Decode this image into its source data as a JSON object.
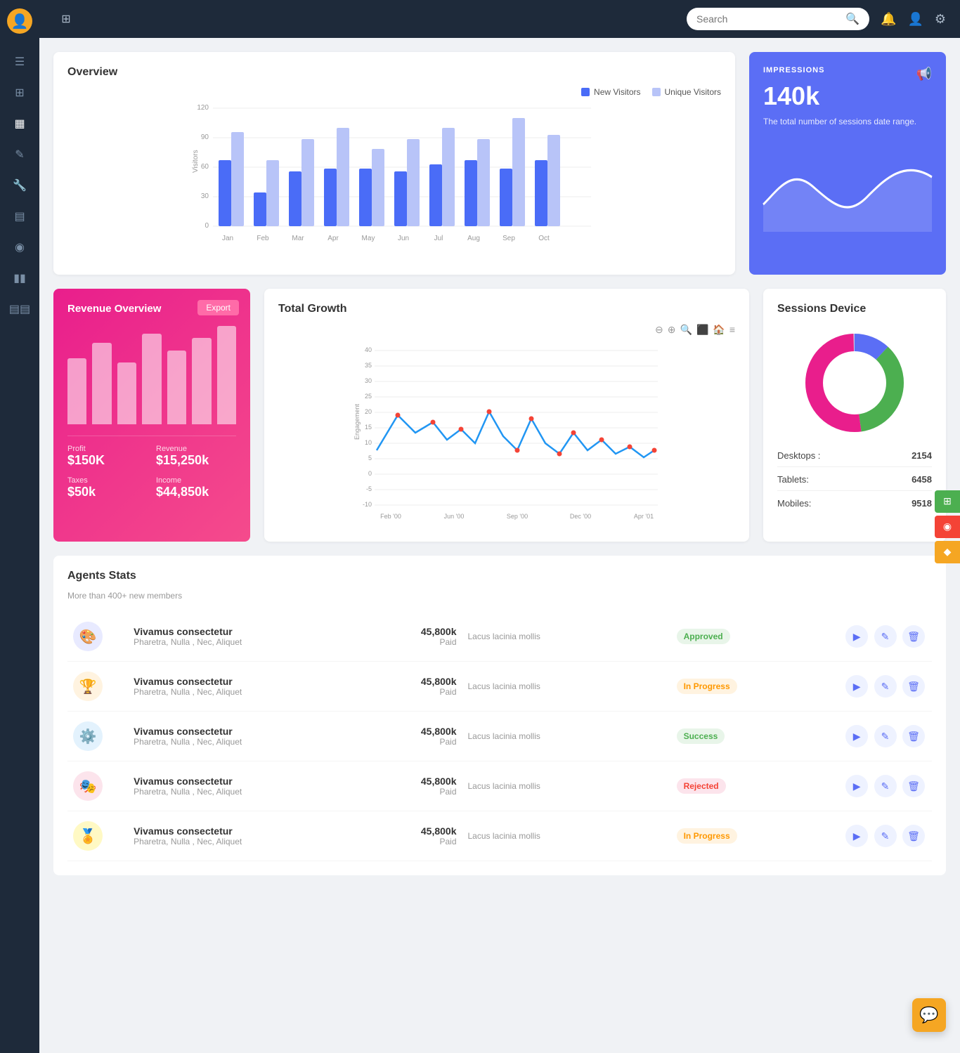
{
  "topbar": {
    "search_placeholder": "Search",
    "search_icon": "🔍"
  },
  "sidebar": {
    "icons": [
      "☰",
      "⊞",
      "▦",
      "✎",
      "🔧",
      "▤",
      "◉",
      "▮▮",
      "▤▤"
    ]
  },
  "overview": {
    "title": "Overview",
    "legend_new": "New Visitors",
    "legend_unique": "Unique Visitors",
    "y_labels": [
      "120",
      "90",
      "60",
      "30",
      "0"
    ],
    "y_title": "Visitors",
    "months": [
      "Jan",
      "Feb",
      "Mar",
      "Apr",
      "May",
      "Jun",
      "Jul",
      "Aug",
      "Sep",
      "Oct"
    ],
    "bars_new": [
      65,
      35,
      55,
      58,
      58,
      55,
      60,
      65,
      58,
      65
    ],
    "bars_unique": [
      100,
      65,
      90,
      105,
      80,
      90,
      105,
      90,
      115,
      95
    ]
  },
  "impressions": {
    "label": "IMPRESSIONS",
    "value": "140k",
    "desc": "The total number of sessions date range."
  },
  "revenue": {
    "title": "Revenue Overview",
    "export_label": "Export",
    "bars_heights": [
      80,
      100,
      75,
      110,
      90,
      105,
      120
    ],
    "stats": [
      {
        "label": "Profit",
        "value": "$150K"
      },
      {
        "label": "Revenue",
        "value": "$15,250k"
      },
      {
        "label": "Taxes",
        "value": "$50k"
      },
      {
        "label": "Income",
        "value": "$44,850k"
      }
    ]
  },
  "total_growth": {
    "title": "Total Growth",
    "x_labels": [
      "Feb '00",
      "Jun '00",
      "Sep '00",
      "Dec '00",
      "Apr '01"
    ],
    "y_labels": [
      "40",
      "35",
      "30",
      "25",
      "20",
      "15",
      "10",
      "5",
      "0",
      "-5",
      "-10"
    ]
  },
  "sessions_device": {
    "title": "Sessions Device",
    "segments": [
      {
        "label": "Desktops",
        "value": 2154,
        "color": "#5b6ef5",
        "percent": 12
      },
      {
        "label": "Tablets",
        "value": 6458,
        "color": "#4caf50",
        "percent": 36
      },
      {
        "label": "Mobiles",
        "value": 9518,
        "color": "#e91e8c",
        "percent": 52
      }
    ],
    "donut_gray": "#e0e0e0",
    "stats": [
      {
        "label": "Desktops :",
        "value": "2154"
      },
      {
        "label": "Tablets:",
        "value": "6458"
      },
      {
        "label": "Mobiles:",
        "value": "9518"
      }
    ]
  },
  "agents": {
    "title": "Agents Stats",
    "subtitle": "More than 400+ new members",
    "rows": [
      {
        "avatar": "🎨",
        "avatar_bg": "#e8eaff",
        "name": "Vivamus consectetur",
        "sub": "Pharetra, Nulla , Nec, Aliquet",
        "amount": "45,800k",
        "paid": "Paid",
        "desc": "Lacus lacinia mollis",
        "status": "Approved",
        "status_class": "status-approved"
      },
      {
        "avatar": "🏆",
        "avatar_bg": "#fff3e0",
        "name": "Vivamus consectetur",
        "sub": "Pharetra, Nulla , Nec, Aliquet",
        "amount": "45,800k",
        "paid": "Paid",
        "desc": "Lacus lacinia mollis",
        "status": "In Progress",
        "status_class": "status-in-progress"
      },
      {
        "avatar": "⚙️",
        "avatar_bg": "#e3f2fd",
        "name": "Vivamus consectetur",
        "sub": "Pharetra, Nulla , Nec, Aliquet",
        "amount": "45,800k",
        "paid": "Paid",
        "desc": "Lacus lacinia mollis",
        "status": "Success",
        "status_class": "status-success"
      },
      {
        "avatar": "🎭",
        "avatar_bg": "#fce4ec",
        "name": "Vivamus consectetur",
        "sub": "Pharetra, Nulla , Nec, Aliquet",
        "amount": "45,800k",
        "paid": "Paid",
        "desc": "Lacus lacinia mollis",
        "status": "Rejected",
        "status_class": "status-rejected"
      },
      {
        "avatar": "🏅",
        "avatar_bg": "#fff9c4",
        "name": "Vivamus consectetur",
        "sub": "Pharetra, Nulla , Nec, Aliquet",
        "amount": "45,800k",
        "paid": "Paid",
        "desc": "Lacus lacinia mollis",
        "status": "In Progress",
        "status_class": "status-in-progress"
      }
    ]
  },
  "side_pills": [
    {
      "color": "#4caf50",
      "icon": "⊞"
    },
    {
      "color": "#f44336",
      "icon": "◉"
    },
    {
      "color": "#f5a623",
      "icon": "◆"
    }
  ],
  "chat_btn": {
    "icon": "💬"
  }
}
